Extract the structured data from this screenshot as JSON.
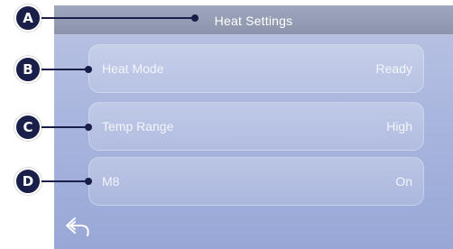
{
  "screen": {
    "title": "Heat Settings",
    "rows": [
      {
        "label": "Heat Mode",
        "value": "Ready"
      },
      {
        "label": "Temp Range",
        "value": "High"
      },
      {
        "label": "M8",
        "value": "On"
      }
    ],
    "back_icon": "back-arrow-icon"
  },
  "callouts": [
    "A",
    "B",
    "C",
    "D"
  ],
  "colors": {
    "callout": "#1a1f4a",
    "title_bar": "#8b94ab",
    "screen_bg": "#a9b6de",
    "text": "#ffffff"
  }
}
